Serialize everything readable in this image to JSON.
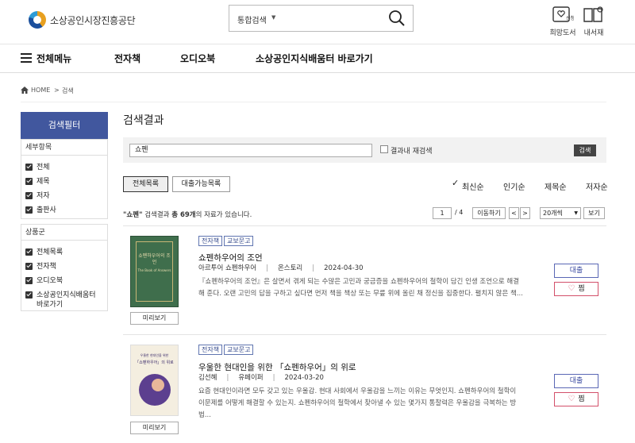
{
  "header": {
    "org_name": "소상공인시장진흥공단",
    "search_scope": "통합검색",
    "hope_books_label": "희망도서",
    "hope_badge": "신청",
    "my_library_label": "내서재"
  },
  "nav": {
    "all_menu": "전체메뉴",
    "items": [
      "전자책",
      "오디오북",
      "소상공인지식배움터 바로가기"
    ]
  },
  "breadcrumb": {
    "home": "HOME",
    "sep": ">",
    "current": "검색"
  },
  "sidebar": {
    "title": "검색필터",
    "detail_group": "세부항목",
    "detail_items": [
      "전체",
      "제목",
      "저자",
      "출판사"
    ],
    "product_group": "상품군",
    "product_items": [
      "전체목록",
      "전자책",
      "오디오북",
      "소상공인지식배움터 바로가기"
    ]
  },
  "results": {
    "title": "검색결과",
    "query": "쇼펜",
    "within_label": "결과내 재검색",
    "search_btn": "검색",
    "tabs": [
      "전체목록",
      "대출가능목록"
    ],
    "sort_options": [
      "최신순",
      "인기순",
      "제목순",
      "저자순"
    ],
    "count_prefix": "\"쇼펜\"",
    "count_mid": " 검색결과 ",
    "count_total": "총 69개",
    "count_suffix": "의 자료가 있습니다.",
    "page_current": "1",
    "page_total": "/ 4",
    "goto_btn": "이동하기",
    "prev": "<",
    "next": ">",
    "rows_per_page": "20개씩",
    "view_btn": "보기"
  },
  "books": [
    {
      "tags": [
        "전자책",
        "교보문고"
      ],
      "title": "쇼펜하우어의 조언",
      "author": "아르투어 쇼펜하우어",
      "publisher": "온스토리",
      "date": "2024-04-30",
      "desc": "『쇼펜하우어의 조언』은 살면서 겪게 되는 수많은 고민과 궁금증을 쇼펜하우어의 철학이 담긴 인생 조언으로 해결해 준다. 오랜 고민의 답을 구하고 싶다면 먼저 책을 책상 또는 무릎 위에 올린 채 정신을 집중한다. 펼치지 않은 책...",
      "cover_title": "쇼펜하우어의 조언",
      "cover_sub": "The Book of Answers",
      "preview": "미리보기",
      "borrow": "대출",
      "fav": "찜"
    },
    {
      "tags": [
        "전자책",
        "교보문고"
      ],
      "title": "우울한 현대인을 위한 「쇼펜하우어」의 위로",
      "author": "김선혜",
      "publisher": "유페이퍼",
      "date": "2024-03-20",
      "desc": "요즘 현대인이라면 모두 갖고 있는 우울감. 현대 사회에서 우울감을 느끼는 이유는 무엇인지. 쇼펜하우어의 철학이 이문제를 어떻게 해결할 수 있는지. 쇼펜하우어의 철학에서 찾아낼 수 있는 몇가지 통찰력은 우울감을 극복하는 방법...",
      "cover_title": "「쇼펜하우어」의 위로",
      "cover_sub": "우울한 현대인을 위한",
      "preview": "미리보기",
      "borrow": "대출",
      "fav": "찜"
    }
  ],
  "colors": {
    "accent": "#41579e",
    "fav": "#d3506a",
    "borrow": "#5a67b5"
  }
}
